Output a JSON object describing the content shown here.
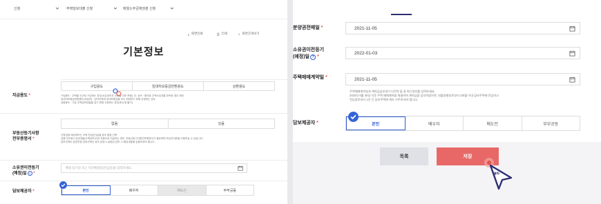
{
  "left_panel": {
    "filters": [
      {
        "label": "신청"
      },
      {
        "label": "주택담보대출 신청"
      },
      {
        "label": "매월노부금채권분 신청"
      }
    ],
    "toolbar": {
      "print": "화면인쇄",
      "save": "인쇄",
      "search": "화면크게보기"
    },
    "page_title": "기본정보",
    "loan_purpose": {
      "label": "자금용도",
      "required_mark": "*",
      "options": [
        "구입용도",
        "임대차보증금반환용도",
        "상환용도"
      ],
      "notes": [
        "구입용도 : 주택을 신규로 구입하는 경우(소유권이전 신청일 이후 포함), 단, 상속 · 증여로 주택소유권을 취득한 경우 제외",
        "임대차보증금반환용도(세입자) : 임차인에게 임대보증금을 모두 반환하기 위해 신청하는 경우",
        "상환용도 : 기존 주택담보대출을 갚기 위해 신청하는 경우(후순위 불가)"
      ]
    },
    "registry_doc": {
      "label": "부동산등기사항\n전부증명서",
      "required_mark": "*",
      "options": [
        "없음",
        "있음"
      ],
      "notes": [
        "신청당일 매입하려는 주택 전금(잔금)을 경우 없음 선택",
        "금융기관에서 전금대출(주택담보)으로 처음으로 취급하는 경우, 부동산등기사항전부증명서가 필요하며 보금자리론을 이용하실 수 있습니다.",
        "담보주택이 분양전환 임대주택인 경우 분양시 설정된 담보 시 해당내용을 입증하셔야 합니다."
      ]
    },
    "ownership_date": {
      "label": "소유권이전등기\n(예정)일",
      "required_mark": "*",
      "placeholder": "예정 등기일 또는 이전예정일(잔금일)을 입력하세요.",
      "help_icon": "question-circle-icon"
    },
    "collateral_provider": {
      "label": "담보제공자",
      "required_mark": "*",
      "options": [
        "본인",
        "배우자",
        "매도인",
        "부부공동"
      ],
      "selected": "본인"
    }
  },
  "right_panel": {
    "sale_contract_date": {
      "label": "분양권전매일",
      "required_mark": "*",
      "value": "2021-11-05"
    },
    "ownership_date": {
      "label": "소유권이전등기\n(예정)일",
      "required_mark": "*",
      "value": "2022-01-03",
      "help_icon": "question-circle-icon"
    },
    "home_contract_date": {
      "label": "주택매매계약일",
      "required_mark": "*",
      "value": "2021-11-05",
      "notes": [
        "주택매매계약일과 계약금납부일이 다르면 둘 중 최근일자를 입력하세요.",
        "2020년 6월 30일 이후 주택 매매계약을 체결하여 계약금을 납부하였으면, 대출실행일로부터 3개월 이내 담보주택에 전입하고",
        "전입일로부터 1년 간 담보주택에 계속 거주하셔야 합니다."
      ]
    },
    "collateral_provider": {
      "label": "담보제공자",
      "required_mark": "*",
      "options": [
        "본인",
        "배우자",
        "매도인",
        "부부공동"
      ],
      "selected": "본인"
    },
    "buttons": {
      "list": "목록",
      "save": "저장"
    },
    "cursor_label": "클릭!"
  },
  "colors": {
    "accent_blue": "#2f5bd0",
    "save_red": "#e86868",
    "required_red": "#e2534b",
    "navy": "#2c2d74"
  }
}
